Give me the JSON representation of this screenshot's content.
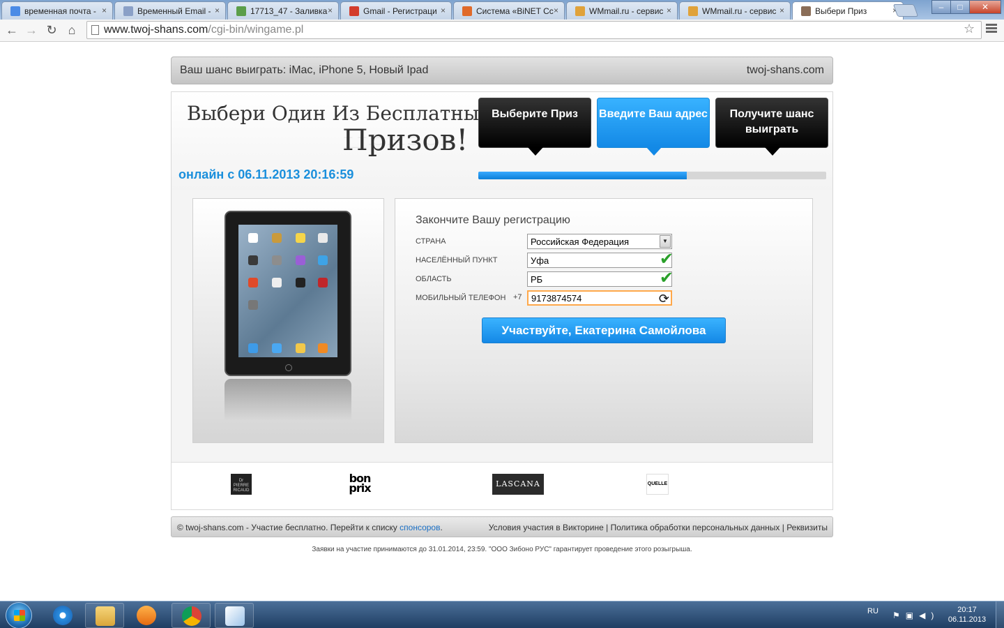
{
  "browser": {
    "tabs": [
      {
        "title": "временная почта -",
        "favicon_color": "#4b8be6",
        "active": false
      },
      {
        "title": "Временный Email -",
        "favicon_color": "#8aa0c7",
        "active": false
      },
      {
        "title": "17713_47 - Заливка",
        "favicon_color": "#5b9e4a",
        "active": false
      },
      {
        "title": "Gmail - Регистраци",
        "favicon_color": "#d33c2c",
        "active": false
      },
      {
        "title": "Система «BiNET Сс",
        "favicon_color": "#e06a2a",
        "active": false
      },
      {
        "title": "WMmail.ru - сервис",
        "favicon_color": "#e0a23a",
        "active": false
      },
      {
        "title": "WMmail.ru - сервис",
        "favicon_color": "#e0a23a",
        "active": false
      },
      {
        "title": "Выбери Приз",
        "favicon_color": "#8a6d57",
        "active": true
      }
    ],
    "close_glyph": "×",
    "url_host": "www.twoj-shans.com",
    "url_path": "/cgi-bin/wingame.pl",
    "icons": {
      "back": "back-arrow-icon",
      "forward": "forward-arrow-icon",
      "reload": "reload-icon",
      "home": "home-icon",
      "bookmark": "star-icon",
      "menu": "menu-icon"
    }
  },
  "page": {
    "topbar": {
      "left": "Ваш шанс выиграть:  iMac, iPhone 5, Новый Ipad",
      "right": "twoj-shans.com"
    },
    "header": {
      "title_line1": "Выбери Один Из Бесплатных",
      "title_line2": "Призов!",
      "online": "онлайн с 06.11.2013 20:16:59"
    },
    "steps": [
      {
        "label": "Выберите Приз",
        "state": "done"
      },
      {
        "label": "Введите Ваш адрес",
        "state": "current"
      },
      {
        "label": "Получите шанс выиграть",
        "state": "pending"
      }
    ],
    "progress": 0.6,
    "colors": {
      "accent": "#1a8fdc",
      "step_active": "#1389e6",
      "step_dark": "#000000",
      "check": "#2aa02a",
      "phone_border": "#ffa84a"
    },
    "form": {
      "title": "Закончите Вашу регистрацию",
      "country_label": "СТРАНА",
      "country_value": "Российская Федерация",
      "city_label": "НАСЕЛЁННЫЙ ПУНКТ",
      "city_value": "Уфа",
      "region_label": "ОБЛАСТЬ",
      "region_value": "РБ",
      "phone_label": "МОБИЛЬНЫЙ ТЕЛЕФОН",
      "phone_prefix": "+7",
      "phone_value": "9173874574",
      "submit": "Участвуйте, Екатерина Самойлова"
    },
    "sponsors": [
      "Pierre Ricaud",
      "bonprix",
      "LASCANA",
      "QUELLE"
    ],
    "footer": {
      "left_prefix": "© twoj-shans.com - Участие бесплатно. Перейти к списку ",
      "left_link": "спонсоров",
      "left_suffix": ".",
      "link_terms": "Условия участия в Викторине",
      "link_privacy": "Политика обработки персональных данных",
      "link_requisites": "Реквизиты",
      "separator": " | "
    },
    "disclaimer": "Заявки на участие принимаются до 31.01.2014, 23:59. \"ООО Зибоно РУС\" гарантирует проведение этого розыгрыша."
  },
  "taskbar": {
    "language": "RU",
    "time": "20:17",
    "date": "06.11.2013",
    "pinned": [
      "internet-explorer-icon",
      "file-explorer-icon",
      "media-player-icon",
      "chrome-icon",
      "paint-icon"
    ]
  }
}
